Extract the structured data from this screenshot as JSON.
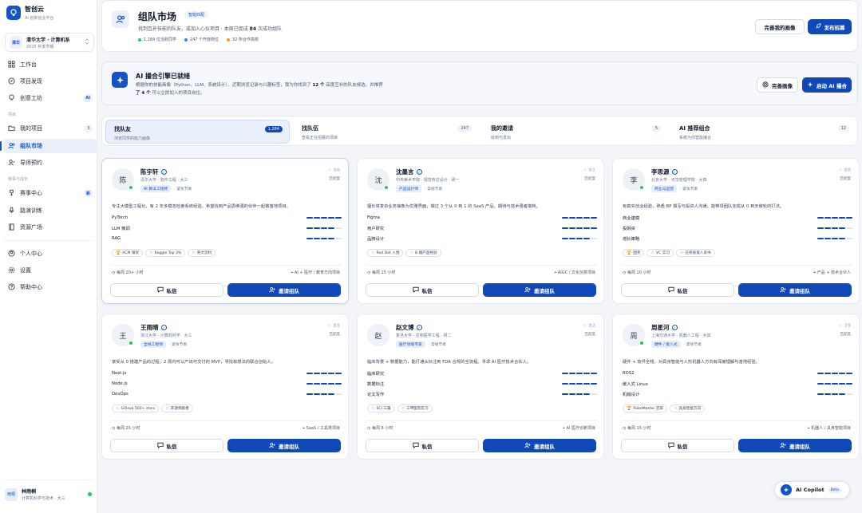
{
  "brand": {
    "name": "智创云",
    "subtitle": "AI 创新创业平台"
  },
  "org": {
    "badge": "清华",
    "name": "清华大学 · 计算机系",
    "term": "2025 秋季学期"
  },
  "nav": {
    "workspace": "工作台",
    "discover": "项目发现",
    "workshop": "创意工坊",
    "workshop_badge": "AI",
    "section_project": "项目",
    "my_projects": "我的项目",
    "my_projects_count": "3",
    "team_market": "组队市场",
    "mentor": "导师预约",
    "section_growth": "赛事与成长",
    "events": "赛事中心",
    "events_badge": "新",
    "pitch": "路演训练",
    "resources": "资源广场",
    "profile": "个人中心",
    "settings": "设置",
    "help": "帮助中心"
  },
  "user": {
    "avatar": "雨桐",
    "name": "林雨桐",
    "sub": "计算机科学与技术 · 大三"
  },
  "hero": {
    "title": "组队市场",
    "tag": "智能匹配",
    "sub_pre": "找到互补技能的队友，或加入心仪项目 · 本周已促成",
    "sub_num": "84",
    "sub_post": "次成功组队",
    "stats": [
      {
        "text": "1,284 位活跃同学",
        "color": "#22c55e"
      },
      {
        "text": "247 个开放岗位",
        "color": "#3b82f6"
      },
      {
        "text": "32 所合作高校",
        "color": "#f59e0b"
      }
    ],
    "btn_profile": "完善我的画像",
    "btn_post": "发布招募"
  },
  "ai": {
    "title": "AI 撮合引擎已就绪",
    "line1_pre": "根据你的技能画像（Python、LLM、系统设计）、近期浏览记录与兴趣标签，我为你找到了",
    "line1_num": "12 个",
    "line1_post": "高度互补的队友候选，并推荐",
    "line2_num": "了 4 个",
    "line2_post": "可以立即加入的项目岗位。",
    "btn_profile": "完善画像",
    "btn_start": "启动 AI 撮合"
  },
  "tabs": [
    {
      "label": "找队友",
      "sub": "浏览同学的能力画像",
      "count": "1,284"
    },
    {
      "label": "找队伍",
      "sub": "查看正在招募的项目",
      "count": "247"
    },
    {
      "label": "我的邀请",
      "sub": "收到与发出",
      "count": "5"
    },
    {
      "label": "AI 推荐组合",
      "sub": "系统为你智能撮合",
      "count": "12"
    }
  ],
  "card_common": {
    "match_label": "匹配度",
    "msg": "私信",
    "invite": "邀请组队"
  },
  "cards": [
    {
      "avatar": "陈",
      "name": "陈宇轩",
      "school": "清华大学 · 软件工程 · 大三",
      "role": "AI 算法工程师",
      "status": "紧张节奏",
      "match": "96",
      "online": true,
      "bio": "专注大模型工程化，有 2 年多模态检索系统经验。希望找到产品思维强的伙伴一起做落地项目。",
      "skills": [
        {
          "name": "PyTorch",
          "level": 5
        },
        {
          "name": "LLM 微调",
          "level": 4
        },
        {
          "name": "RAG",
          "level": 4
        }
      ],
      "badges": [
        {
          "icon": "🏆",
          "text": "ACM 银奖"
        },
        {
          "icon": "☆",
          "text": "Kaggle Top 3%"
        },
        {
          "icon": "☆",
          "text": "英文流利"
        }
      ],
      "hours": "每周 20+ 小时",
      "area": "AI + 医疗 / 教育方向项目"
    },
    {
      "avatar": "沈",
      "name": "沈墨言",
      "school": "中央美术学院 · 视觉传达设计 · 研一",
      "role": "产品设计师",
      "status": "常规节奏",
      "match": "91",
      "online": true,
      "bio": "擅长将复杂业务抽象为优雅界面，做过 3 个从 0 到 1 的 SaaS 产品，期待与技术强者搭档。",
      "skills": [
        {
          "name": "Figma",
          "level": 5
        },
        {
          "name": "用户研究",
          "level": 5
        },
        {
          "name": "品牌设计",
          "level": 4
        }
      ],
      "badges": [
        {
          "icon": "☆",
          "text": "Red Dot 入围"
        },
        {
          "icon": "☆",
          "text": "B 端产品经验"
        }
      ],
      "hours": "每周 15 小时",
      "area": "AIGC / 文化创意项目"
    },
    {
      "avatar": "李",
      "name": "李思源",
      "school": "北京大学 · 光华管理学院 · 大四",
      "role": "商业与运营",
      "status": "紧张节奏",
      "match": "88",
      "online": true,
      "bio": "有真实创业经验，熟悉 BP 撰写与投资人沟通，能带领团队完成从 0 到天使轮的打法。",
      "skills": [
        {
          "name": "商业建模",
          "level": 5
        },
        {
          "name": "投融资",
          "level": 4
        },
        {
          "name": "增长策略",
          "level": 4
        }
      ],
      "badges": [
        {
          "icon": "🏆",
          "text": "国奖"
        },
        {
          "icon": "☆",
          "text": "VC 实习"
        },
        {
          "icon": "☆",
          "text": "已有投资人背书"
        }
      ],
      "hours": "每周 10 小时",
      "area": "产品 + 技术合伙人"
    },
    {
      "avatar": "王",
      "name": "王雨晴",
      "school": "浙江大学 · 计算机科学 · 大三",
      "role": "全栈工程师",
      "status": "紧张节奏",
      "match": "85",
      "online": true,
      "bio": "享受从 0 搭建产品的过程，2 周内可以产出可交付的 MVP，寻找有想法的联合创始人。",
      "skills": [
        {
          "name": "Next.js",
          "level": 5
        },
        {
          "name": "Node.js",
          "level": 5
        },
        {
          "name": "DevOps",
          "level": 4
        }
      ],
      "badges": [
        {
          "icon": "☆",
          "text": "GitHub 500+ stars"
        },
        {
          "icon": "☆",
          "text": "开源贡献者"
        }
      ],
      "hours": "每周 25 小时",
      "area": "SaaS / 工具类项目"
    },
    {
      "avatar": "赵",
      "name": "赵文博",
      "school": "复旦大学 · 生物医学工程 · 研二",
      "role": "医疗领域专家",
      "status": "常规节奏",
      "match": "82",
      "online": false,
      "bio": "临床背景 + 数据能力，能打通从标注到 FDA 合规的全流程。寻求 AI 医疗技术合伙人。",
      "skills": [
        {
          "name": "临床研究",
          "level": 5
        },
        {
          "name": "数据标注",
          "level": 5
        },
        {
          "name": "论文写作",
          "level": 4
        }
      ],
      "badges": [
        {
          "icon": "☆",
          "text": "SCI 三篇"
        },
        {
          "icon": "☆",
          "text": "三甲医院实习"
        }
      ],
      "hours": "每周 8 小时",
      "area": "AI 医疗诊断项目"
    },
    {
      "avatar": "周",
      "name": "周星河",
      "school": "上海交通大学 · 机器人工程 · 大四",
      "role": "硬件 / 嵌入式",
      "status": "紧张节奏",
      "match": "79",
      "online": true,
      "bio": "硬件 + 软件全栈，对具身智能与人形机器人方向有深度理解与落地经验。",
      "skills": [
        {
          "name": "ROS2",
          "level": 5
        },
        {
          "name": "嵌入式 Linux",
          "level": 5
        },
        {
          "name": "机械设计",
          "level": 4
        }
      ],
      "badges": [
        {
          "icon": "🏆",
          "text": "RoboMaster 冠军"
        },
        {
          "icon": "☆",
          "text": "具身智能方向"
        }
      ],
      "hours": "每周 15 小时",
      "area": "机器人 / 具身智能项目"
    }
  ],
  "copilot": {
    "label": "AI Copilot",
    "beta": "Beta"
  }
}
